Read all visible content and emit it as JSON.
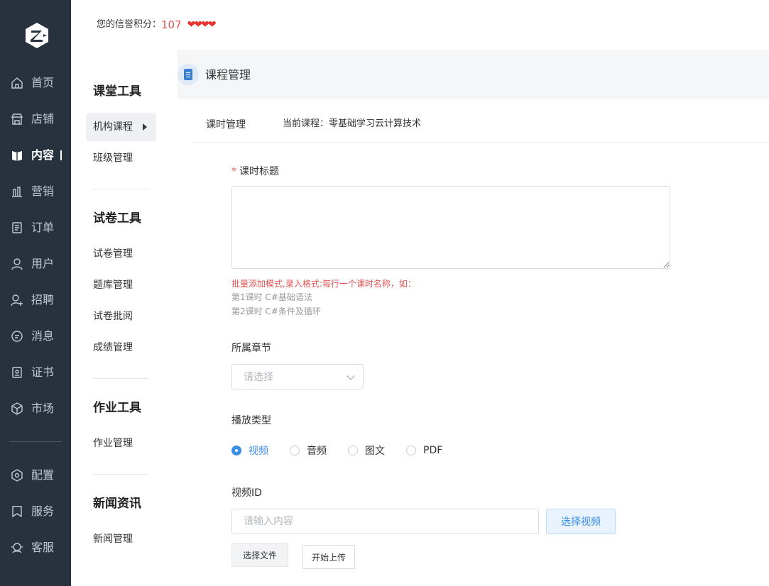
{
  "header": {
    "credit_label": "您的信誉积分：",
    "credit_score": "107",
    "hearts": "❤❤❤❤"
  },
  "sidebar": {
    "items": [
      {
        "label": "首页",
        "icon": "home-icon"
      },
      {
        "label": "店铺",
        "icon": "store-icon"
      },
      {
        "label": "内容",
        "icon": "book-icon",
        "active": true
      },
      {
        "label": "营销",
        "icon": "bar-chart-icon"
      },
      {
        "label": "订单",
        "icon": "order-icon"
      },
      {
        "label": "用户",
        "icon": "user-icon"
      },
      {
        "label": "招聘",
        "icon": "recruit-icon"
      },
      {
        "label": "消息",
        "icon": "message-icon"
      },
      {
        "label": "证书",
        "icon": "certificate-icon"
      },
      {
        "label": "市场",
        "icon": "market-icon"
      },
      {
        "label": "配置",
        "icon": "gear-icon"
      },
      {
        "label": "服务",
        "icon": "bookmark-icon"
      },
      {
        "label": "客服",
        "icon": "support-icon"
      }
    ]
  },
  "submenu": {
    "groups": [
      {
        "title": "课堂工具",
        "items": [
          "机构课程",
          "班级管理"
        ]
      },
      {
        "title": "试卷工具",
        "items": [
          "试卷管理",
          "题库管理",
          "试卷批阅",
          "成绩管理"
        ]
      },
      {
        "title": "作业工具",
        "items": [
          "作业管理"
        ]
      },
      {
        "title": "新闻资讯",
        "items": [
          "新闻管理"
        ]
      }
    ]
  },
  "page": {
    "title": "课程管理",
    "tab": "课时管理",
    "current_course": "当前课程：零基础学习云计算技术"
  },
  "form": {
    "lesson_title_label": "课时标题",
    "required_mark": "*",
    "hint_line1": "批量添加模式,录入格式:每行一个课时名称，如：",
    "hint_line2": "第1课时 C#基础语法",
    "hint_line3": "第2课时 C#条件及循环",
    "chapter_label": "所属章节",
    "chapter_placeholder": "请选择",
    "play_type_label": "播放类型",
    "play_types": [
      "视频",
      "音频",
      "图文",
      "PDF"
    ],
    "video_id_label": "视频ID",
    "video_id_placeholder": "请输入内容",
    "pick_video_button": "选择视频",
    "choose_file_button": "选择文件",
    "start_upload_button": "开始上传"
  }
}
